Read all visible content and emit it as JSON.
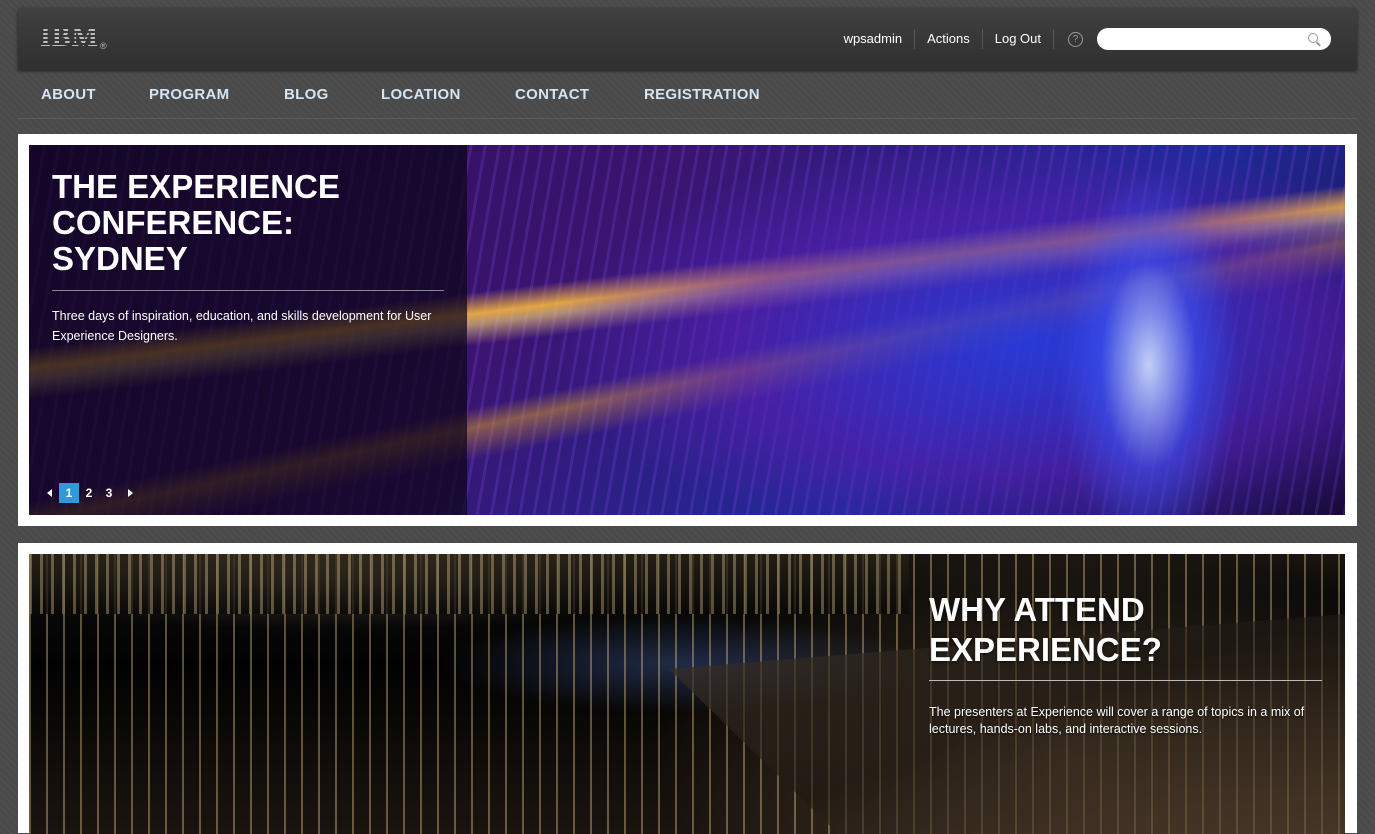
{
  "header": {
    "logo": {
      "letters": "IBM",
      "reg": "®"
    },
    "user": "wpsadmin",
    "actions": "Actions",
    "logout": "Log Out",
    "help_icon": "help-icon",
    "search": {
      "placeholder": "",
      "icon": "search-icon"
    }
  },
  "nav": {
    "items": [
      {
        "label": "ABOUT"
      },
      {
        "label": "PROGRAM"
      },
      {
        "label": "BLOG"
      },
      {
        "label": "LOCATION"
      },
      {
        "label": "CONTACT"
      },
      {
        "label": "REGISTRATION"
      }
    ]
  },
  "hero": {
    "title": "THE EXPERIENCE CONFERENCE: SYDNEY",
    "description": "Three days of inspiration, education, and skills development for User Experience Designers.",
    "pager": {
      "pages": [
        "1",
        "2",
        "3"
      ],
      "active": "1"
    }
  },
  "why": {
    "title": "WHY ATTEND EXPERIENCE?",
    "description": "The presenters at Experience will cover a range of topics in a mix of lectures, hands-on labs, and interactive sessions."
  },
  "colors": {
    "nav_text": "#d4e4f2",
    "pager_active": "#2d9bd9",
    "background": "#4a4a4a"
  }
}
